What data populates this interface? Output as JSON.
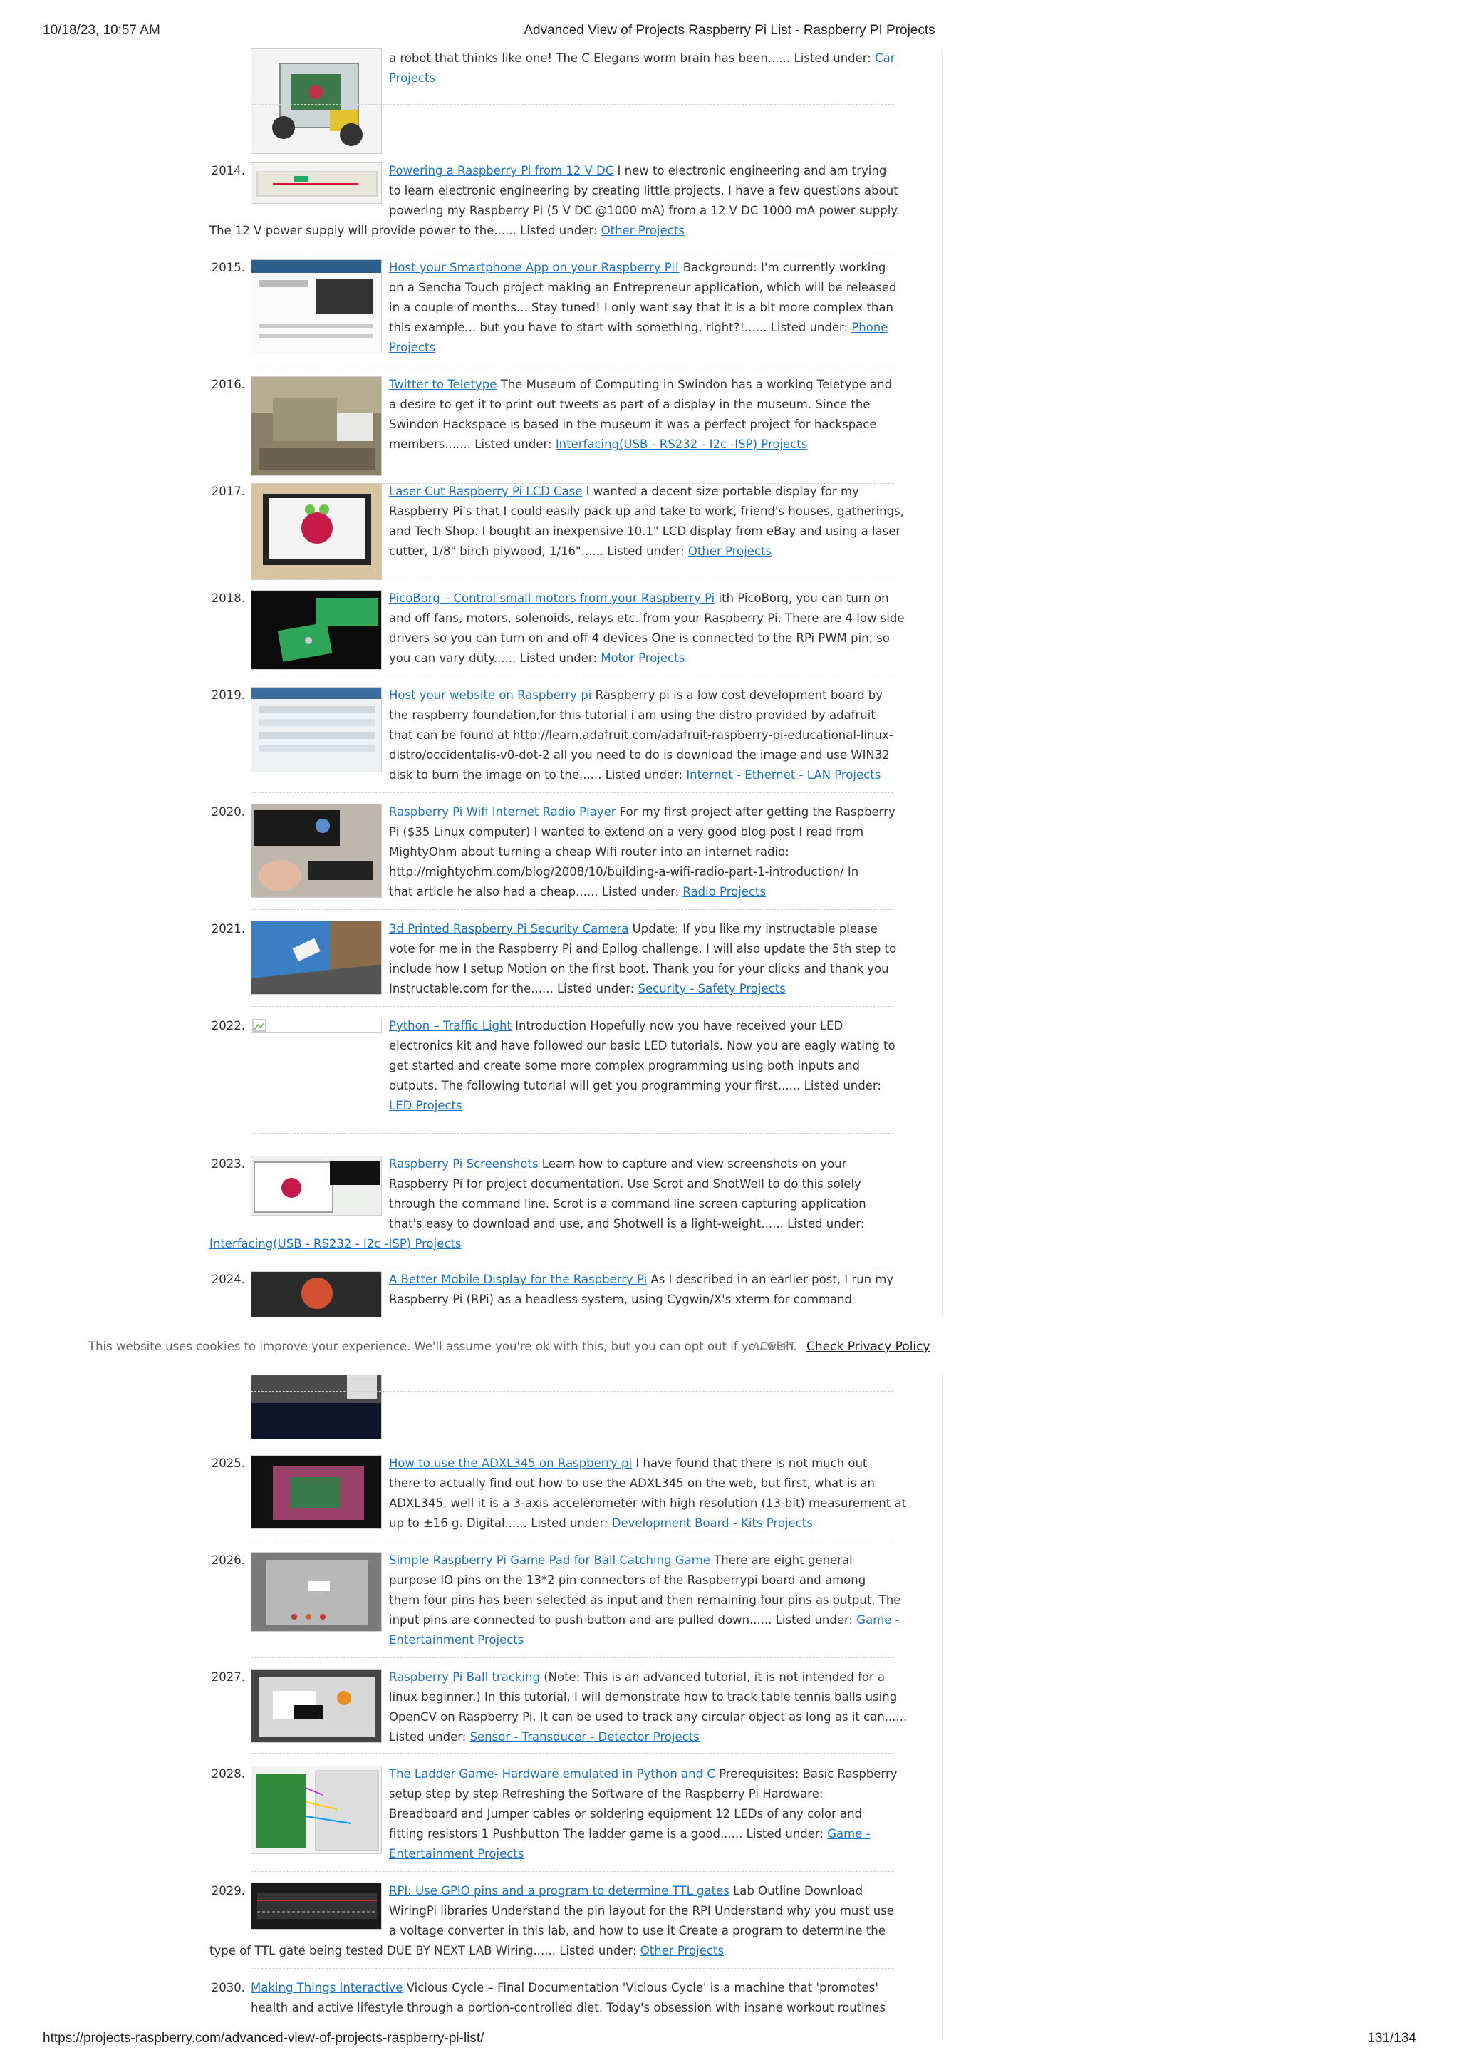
{
  "header": {
    "datetime": "10/18/23, 10:57 AM",
    "title": "Advanced View of Projects Raspberry Pi List - Raspberry PI Projects"
  },
  "footer": {
    "url": "https://projects-raspberry.com/advanced-view-of-projects-raspberry-pi-list/",
    "page": "131/134"
  },
  "cookie_bar": {
    "message": "This website uses cookies to improve your experience. We'll assume you're ok with this, but you can opt out if you wish.",
    "accept": "ACCEPT",
    "privacy": "Check Privacy Policy"
  },
  "partial_top": {
    "lines": [
      "a robot that thinks like one! The C Elegans worm brain has been...... Listed under: "
    ],
    "cat_a": "Car",
    "cat_b": "Projects",
    "thumb_icon": "robot-car-photo"
  },
  "items": [
    {
      "num": "2014.",
      "link": "Powering a Raspberry Pi from 12 V DC",
      "l1": " I new to electronic engineering and am trying",
      "l2": "to learn electronic engineering by creating little projects. I have a few questions about",
      "l3": "powering my Raspberry Pi (5 V DC @1000 mA) from a 12 V DC 1000 mA power supply.",
      "l4": "The 12 V power supply will provide power to the...... Listed under: ",
      "cat": "Other Projects"
    },
    {
      "num": "2015.",
      "link": "Host your Smartphone App on your Raspberry Pi!",
      "l1": " Background: I'm currently working",
      "l2": "on a Sencha Touch project making an Entrepreneur application, which will be released",
      "l3": "in a couple of months... Stay tuned! I only want say that it is a bit more complex than",
      "l4": "this example... but you have to start with something, right?!...... Listed under: ",
      "cat_a": "Phone",
      "cat_b": "Projects"
    },
    {
      "num": "2016.",
      "link": "Twitter to Teletype",
      "l1": " The Museum of Computing in Swindon has a working Teletype and",
      "l2": "a desire to get it to print out tweets as part of a display in the museum. Since the",
      "l3": "Swindon Hackspace is based in the museum it was a perfect project for hackspace",
      "l4": "members....... Listed under: ",
      "cat": "Interfacing(USB - RS232 - I2c -ISP) Projects"
    },
    {
      "num": "2017.",
      "link": "Laser Cut Raspberry Pi LCD Case",
      "l1": " I wanted a decent size portable display for my",
      "l2": "Raspberry Pi's that I could easily pack up and take to work, friend's houses, gatherings,",
      "l3": "and Tech Shop. I bought an inexpensive 10.1\" LCD display from eBay and using a laser",
      "l4": "cutter, 1/8\" birch plywood, 1/16\"...... Listed under: ",
      "cat": "Other Projects"
    },
    {
      "num": "2018.",
      "link": "PicoBorg – Control small motors from your Raspberry Pi",
      "l1": " ith PicoBorg, you can turn on",
      "l2": "and off fans, motors, solenoids, relays etc. from your Raspberry Pi. There are 4 low side",
      "l3": "drivers so you can turn on and off 4 devices One is connected to the RPi PWM pin, so",
      "l4": "you can vary duty...... Listed under: ",
      "cat": "Motor Projects"
    },
    {
      "num": "2019.",
      "link": "Host your website on Raspberry pi",
      "l1": " Raspberry pi is a low cost development board by",
      "l2": "the raspberry foundation,for this tutorial i am using the distro provided by adafruit",
      "l3": "that can be found at http://learn.adafruit.com/adafruit-raspberry-pi-educational-linux-",
      "l4": "distro/occidentalis-v0-dot-2 all you need to do is download the image and use WIN32",
      "l5": "disk to burn the image on to the...... Listed under: ",
      "cat": "Internet - Ethernet - LAN Projects"
    },
    {
      "num": "2020.",
      "link": "Raspberry Pi Wifi Internet Radio Player",
      "l1": " For my first project after getting the Raspberry",
      "l2": "Pi ($35 Linux computer) I wanted to extend on a very good blog post I read from",
      "l3": "MightyOhm about turning a cheap Wifi router into an internet radio:",
      "l4": "http://mightyohm.com/blog/2008/10/building-a-wifi-radio-part-1-introduction/ In",
      "l5": "that article he also had a cheap...... Listed under: ",
      "cat": "Radio Projects"
    },
    {
      "num": "2021.",
      "link": "3d Printed Raspberry Pi Security Camera",
      "l1": " Update: If you like my instructable please",
      "l2": "vote for me in the Raspberry Pi and Epilog challenge. I will also update the 5th step to",
      "l3": "include how I setup Motion on the first boot. Thank you for your clicks and thank you",
      "l4": "Instructable.com for the...... Listed under: ",
      "cat": "Security - Safety Projects"
    },
    {
      "num": "2022.",
      "link": "Python – Traffic Light",
      "l1": " Introduction Hopefully now you have received your LED",
      "l2": "electronics kit and have followed our basic LED tutorials. Now you are eagly wating to",
      "l3": "get started and create some more complex programming using both inputs and",
      "l4": "outputs. The following tutorial will get you programming your first...... Listed under:",
      "cat": "LED Projects"
    },
    {
      "num": "2023.",
      "link": "Raspberry Pi Screenshots",
      "l1": " Learn how to capture and view screenshots on your",
      "l2": "Raspberry Pi for project documentation. Use Scrot and ShotWell to do this solely",
      "l3": "through the command line. Scrot is a command line screen capturing application",
      "l4": "that's easy to download and use, and Shotwell is a light-weight...... Listed under:",
      "cat": "Interfacing(USB - RS232 - I2c -ISP) Projects"
    },
    {
      "num": "2024.",
      "link": "A Better Mobile Display for the Raspberry Pi",
      "l1": " As I described in an earlier post, I run my",
      "l2": "Raspberry Pi (RPi) as a headless system, using Cygwin/X's xterm for command"
    },
    {
      "num": "2025.",
      "link": "How to use the ADXL345 on Raspberry pi",
      "l1": " I have found that there is not much out",
      "l2": "there to actually find out how to use the ADXL345 on the web, but first, what is an",
      "l3": "ADXL345, well it is a 3-axis accelerometer with high resolution (13-bit) measurement at",
      "l4": "up to ±16 g. Digital...... Listed under: ",
      "cat": "Development Board - Kits Projects"
    },
    {
      "num": "2026.",
      "link": "Simple Raspberry Pi Game Pad for Ball Catching Game",
      "l1": " There are eight general",
      "l2": "purpose IO pins on the 13*2 pin connectors of the Raspberrypi board and among",
      "l3": "them four pins has been selected as input and then remaining four pins as output. The",
      "l4": "input pins are connected to push button and are pulled down...... Listed under: ",
      "cat_a": "Game -",
      "cat_b": "Entertainment Projects"
    },
    {
      "num": "2027.",
      "link": "Raspberry Pi Ball tracking",
      "l1": " (Note: This is an advanced tutorial, it is not intended for a",
      "l2": "linux beginner.) In this tutorial, I will demonstrate how to track table tennis balls using",
      "l3": "OpenCV on Raspberry Pi. It can be used to track any circular object as long as it can......",
      "l4": "Listed under: ",
      "cat": "Sensor - Transducer - Detector Projects"
    },
    {
      "num": "2028.",
      "link": "The Ladder Game- Hardware emulated in Python and C",
      "l1": " Prerequisites: Basic Raspberry",
      "l2": "setup step by step    Refreshing the Software of the Raspberry Pi     Hardware:",
      "l3": "Breadboard and Jumper cables or soldering equipment    12 LEDs of any color and",
      "l4": "fitting resistors    1 Pushbutton     The ladder game is a good...... Listed under: ",
      "cat_a": "Game -",
      "cat_b": "Entertainment Projects"
    },
    {
      "num": "2029.",
      "link": "RPI: Use GPIO pins and a program to determine TTL gates",
      "l1": " Lab Outline Download",
      "l2": "WiringPi libraries Understand the pin layout for the RPI Understand why you must use",
      "l3": "a voltage converter in this lab, and how to use it Create a program to determine the",
      "l4": "type of TTL gate being tested DUE BY NEXT LAB Wiring...... Listed under: ",
      "cat": "Other Projects"
    },
    {
      "num": "2030.",
      "link": "Making Things Interactive",
      "l1": " Vicious Cycle – Final Documentation 'Vicious Cycle' is a machine that 'promotes'",
      "l2": "health and active lifestyle through a portion-controlled diet. Today's obsession with insane workout routines"
    }
  ]
}
